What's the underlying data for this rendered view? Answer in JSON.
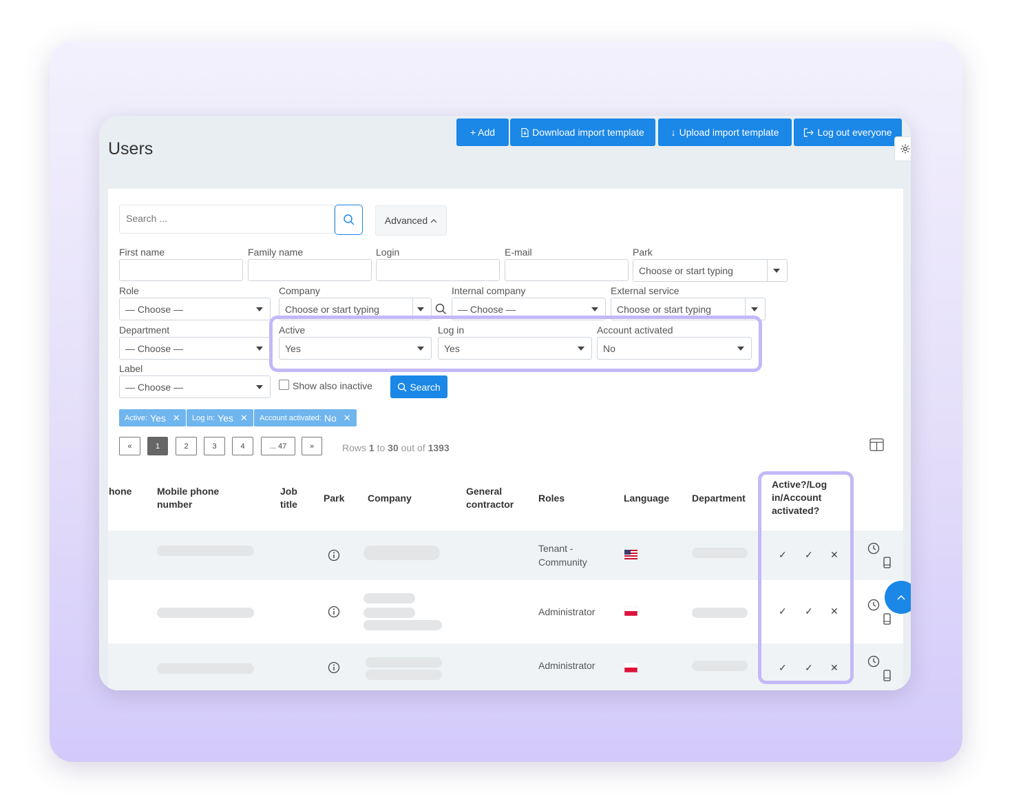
{
  "header": {
    "title": "Users",
    "buttons": {
      "add": "+ Add",
      "download": "Download import template",
      "upload": "Upload import template",
      "logout": "Log out everyone"
    }
  },
  "search": {
    "placeholder": "Search ...",
    "advanced_label": "Advanced"
  },
  "filters": {
    "first_name": "First name",
    "family_name": "Family name",
    "login": "Login",
    "email": "E-mail",
    "park": "Park",
    "park_placeholder": "Choose or start typing",
    "role": "Role",
    "role_value": "— Choose —",
    "company": "Company",
    "company_placeholder": "Choose or start typing",
    "internal_company": "Internal company",
    "internal_company_value": "— Choose —",
    "external_service": "External service",
    "external_service_placeholder": "Choose or start typing",
    "department": "Department",
    "department_value": "— Choose —",
    "active": "Active",
    "active_value": "Yes",
    "log_in": "Log in",
    "log_in_value": "Yes",
    "account_activated": "Account activated",
    "account_activated_value": "No",
    "label": "Label",
    "label_value": "— Choose —",
    "show_inactive": "Show also inactive",
    "search_button": "Search"
  },
  "active_tags": [
    {
      "key": "Active:",
      "value": "Yes"
    },
    {
      "key": "Log in:",
      "value": "Yes"
    },
    {
      "key": "Account activated:",
      "value": "No"
    }
  ],
  "pagination": {
    "prev": "«",
    "p1": "1",
    "p2": "2",
    "p3": "3",
    "p4": "4",
    "more": "... 47",
    "next": "»",
    "rows_prefix": "Rows",
    "rows_from": "1",
    "rows_to_word": "to",
    "rows_to": "30",
    "rows_of_word": "out of",
    "rows_total": "1393"
  },
  "table": {
    "headers": {
      "phone": "hone",
      "mobile": "Mobile phone number",
      "job": "Job title",
      "park": "Park",
      "company": "Company",
      "contractor": "General contractor",
      "roles": "Roles",
      "language": "Language",
      "department": "Department",
      "status": "Active?/Log in/Account activated?"
    },
    "rows": [
      {
        "role": "Tenant - Community",
        "flag": "us",
        "active": "✓",
        "login": "✓",
        "account": "✕"
      },
      {
        "role": "Administrator",
        "flag": "pl",
        "active": "✓",
        "login": "✓",
        "account": "✕"
      },
      {
        "role": "Administrator",
        "flag": "pl",
        "active": "✓",
        "login": "✓",
        "account": "✕"
      }
    ]
  },
  "colors": {
    "primary": "#1b87e6",
    "highlight": "#c4b8f7",
    "tag": "#6fb5ee"
  }
}
